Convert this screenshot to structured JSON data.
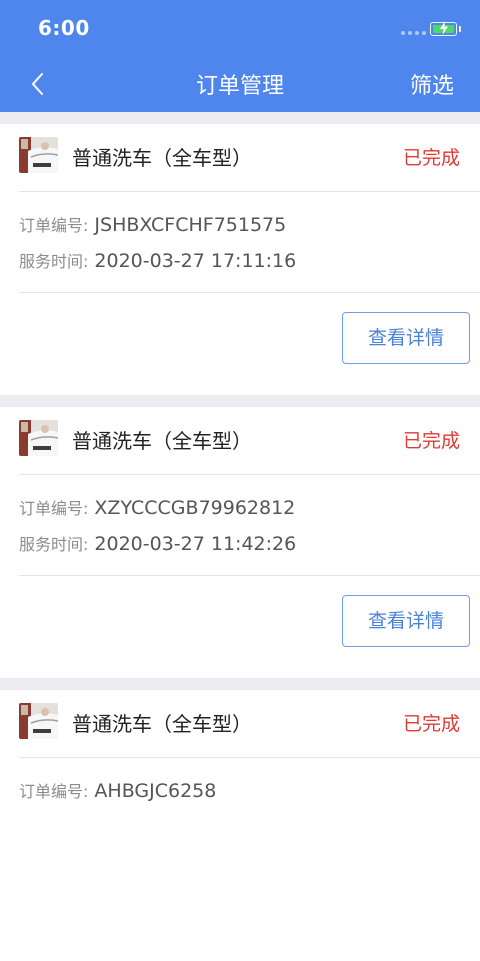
{
  "status_bar": {
    "time": "6:00"
  },
  "nav": {
    "title": "订单管理",
    "filter_label": "筛选"
  },
  "orders": [
    {
      "service": "普通洗车（全车型）",
      "status": "已完成",
      "order_no_label": "订单编号:",
      "order_no": "JSHBXCFCHF751575",
      "service_time_label": "服务时间:",
      "service_time": "2020-03-27 17:11:16",
      "detail_label": "查看详情"
    },
    {
      "service": "普通洗车（全车型）",
      "status": "已完成",
      "order_no_label": "订单编号:",
      "order_no": "XZYCCCGB79962812",
      "service_time_label": "服务时间:",
      "service_time": "2020-03-27 11:42:26",
      "detail_label": "查看详情"
    },
    {
      "service": "普通洗车（全车型）",
      "status": "已完成",
      "order_no_label": "订单编号:",
      "order_no": "AHBGJC6258"
    }
  ],
  "colors": {
    "header": "#4f86ee",
    "status_completed": "#e03a36",
    "detail_button": "#4a82d8",
    "background": "#ececf1"
  },
  "icons": {
    "back": "chevron-left-icon",
    "battery": "battery-charging-icon",
    "thumbnail": "car-wash-thumbnail"
  }
}
